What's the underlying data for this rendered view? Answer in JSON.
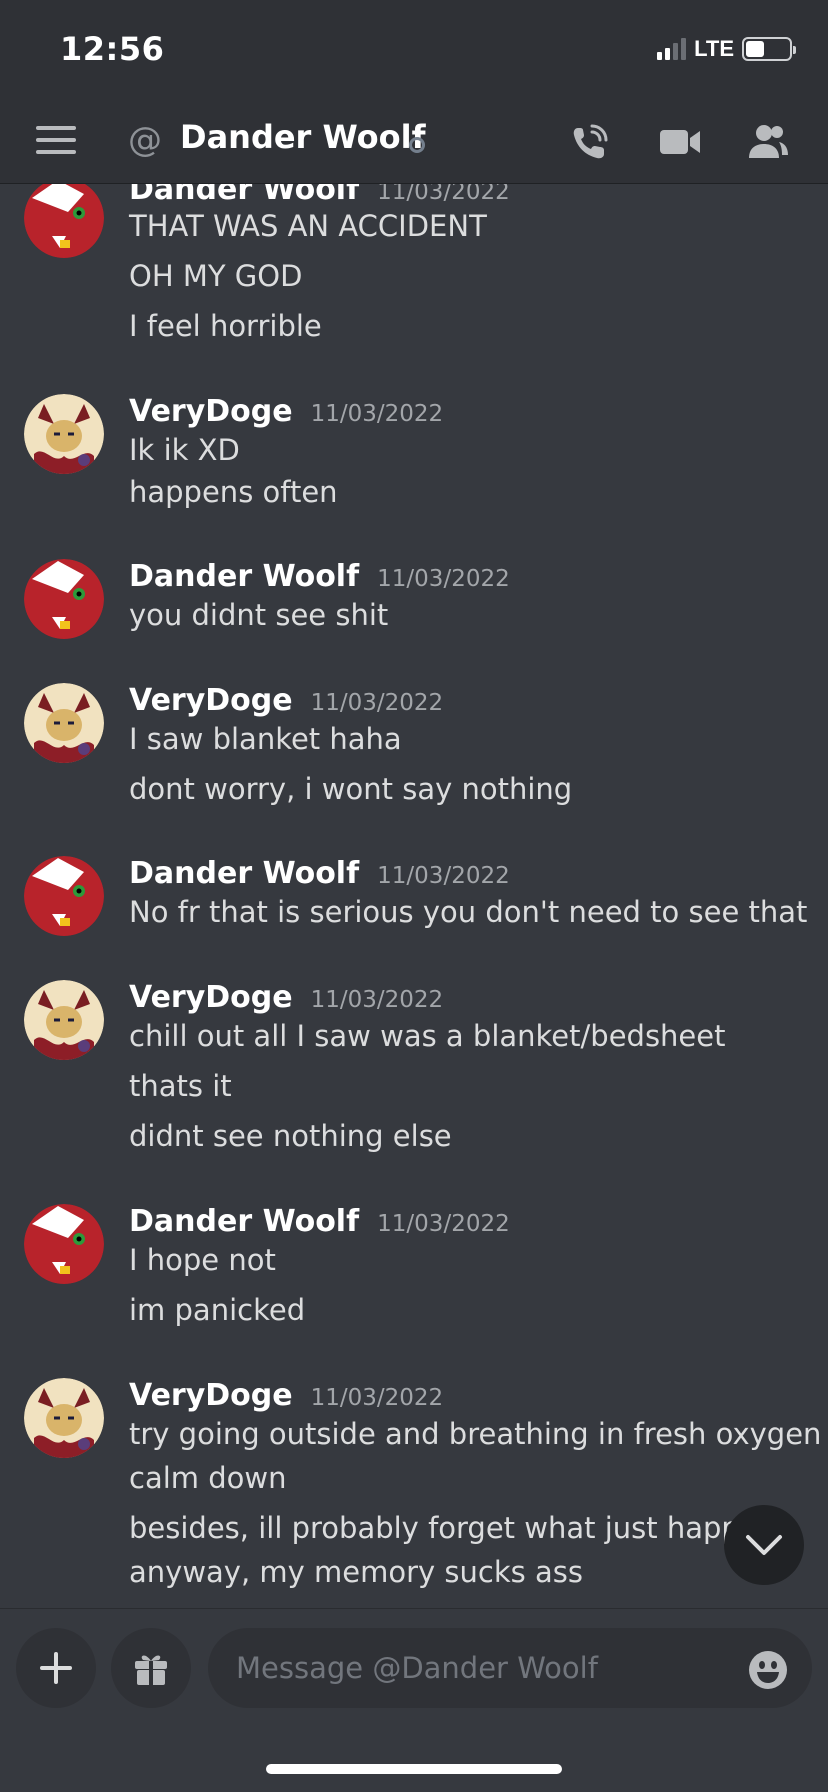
{
  "status_bar": {
    "time": "12:56",
    "network": "LTE",
    "battery_fraction": 0.3
  },
  "header": {
    "channel_title": "Dander Woolf",
    "icons": [
      "menu-icon",
      "at-icon",
      "call-icon",
      "video-icon",
      "members-icon"
    ]
  },
  "messages": [
    {
      "author": "Dander Woolf",
      "timestamp": "11/03/2022",
      "avatar": "red-fox-avatar",
      "lines": [
        "THAT WAS AN ACCIDENT",
        "OH MY GOD",
        "I feel horrible"
      ]
    },
    {
      "author": "VeryDoge",
      "timestamp": "11/03/2022",
      "avatar": "doge-avatar",
      "lines": [
        "Ik ik XD",
        "happens often"
      ]
    },
    {
      "author": "Dander Woolf",
      "timestamp": "11/03/2022",
      "avatar": "red-fox-avatar",
      "lines": [
        "you didnt see shit"
      ]
    },
    {
      "author": "VeryDoge",
      "timestamp": "11/03/2022",
      "avatar": "doge-avatar",
      "lines": [
        "I saw blanket haha",
        "dont worry, i wont say nothing"
      ]
    },
    {
      "author": "Dander Woolf",
      "timestamp": "11/03/2022",
      "avatar": "red-fox-avatar",
      "lines": [
        "No fr that is serious you don't need to see that"
      ]
    },
    {
      "author": "VeryDoge",
      "timestamp": "11/03/2022",
      "avatar": "doge-avatar",
      "lines": [
        "chill out all I saw was a blanket/bedsheet",
        "thats it",
        "didnt see nothing else"
      ]
    },
    {
      "author": "Dander Woolf",
      "timestamp": "11/03/2022",
      "avatar": "red-fox-avatar",
      "lines": [
        "I hope not",
        "im panicked"
      ]
    },
    {
      "author": "VeryDoge",
      "timestamp": "11/03/2022",
      "avatar": "doge-avatar",
      "lines": [
        "try going outside and breathing in fresh oxygen to",
        "calm down",
        "besides, ill probably forget what just happene",
        "anyway, my memory sucks ass"
      ]
    }
  ],
  "composer": {
    "placeholder": "Message @Dander Woolf",
    "icons": [
      "plus-icon",
      "gift-icon",
      "emoji-icon",
      "chevron-down-icon"
    ]
  },
  "colors": {
    "background": "#36393f",
    "header_bg": "#2f3136",
    "text": "#dcddde",
    "muted": "#a3a6aa"
  }
}
